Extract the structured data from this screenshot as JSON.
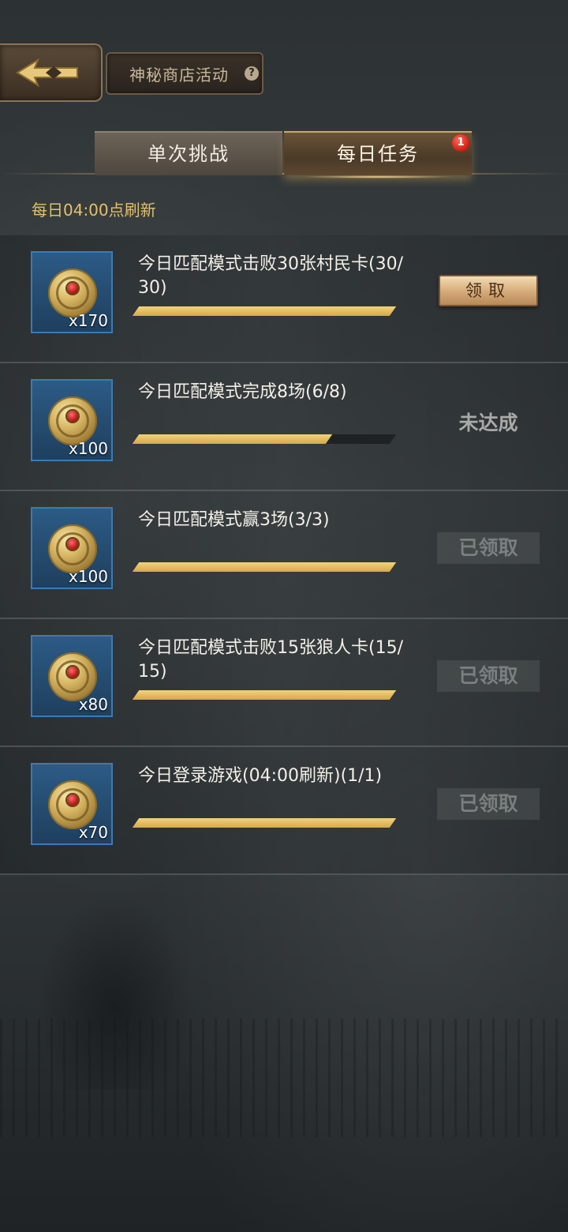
{
  "header": {
    "back_icon": "arrow-left-icon",
    "title": "神秘商店活动",
    "help_glyph": "?"
  },
  "tabs": [
    {
      "label": "单次挑战",
      "active": false
    },
    {
      "label": "每日任务",
      "active": true,
      "badge": "1"
    }
  ],
  "refresh_note": "每日04:00点刷新",
  "colors": {
    "accent_gold": "#e4c06a",
    "progress_gold": "#d6a94a",
    "reward_frame": "#2c5b86",
    "badge_red": "#d01a10"
  },
  "tasks": [
    {
      "reward_qty": "x170",
      "text": "今日匹配模式击败30张村民卡(30/30)",
      "progress": 1.0,
      "state": "claim",
      "action_label": "领取"
    },
    {
      "reward_qty": "x100",
      "text": "今日匹配模式完成8场(6/8)",
      "progress": 0.75,
      "state": "incomplete",
      "action_label": "未达成"
    },
    {
      "reward_qty": "x100",
      "text": "今日匹配模式赢3场(3/3)",
      "progress": 1.0,
      "state": "claimed",
      "action_label": "已领取"
    },
    {
      "reward_qty": "x80",
      "text": "今日匹配模式击败15张狼人卡(15/15)",
      "progress": 1.0,
      "state": "claimed",
      "action_label": "已领取"
    },
    {
      "reward_qty": "x70",
      "text": "今日登录游戏(04:00刷新)(1/1)",
      "progress": 1.0,
      "state": "claimed",
      "action_label": "已领取"
    }
  ]
}
